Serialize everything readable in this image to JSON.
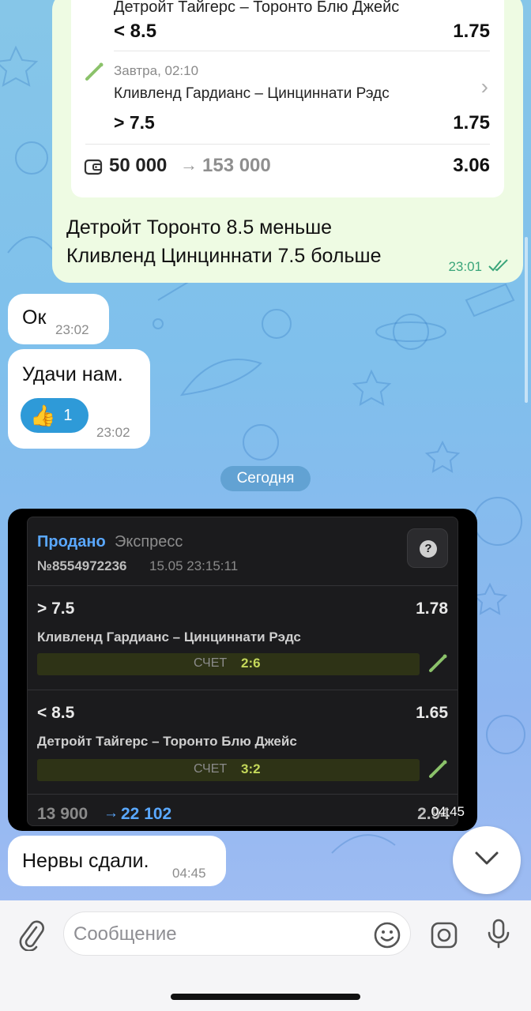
{
  "card": {
    "match1": "Детройт Тайгерс – Торонто Блю Джейс",
    "bet1": "< 8.5",
    "odd1": "1.75",
    "time2": "Завтра, 02:10",
    "match2": "Кливленд Гардианс – Цинциннати Рэдс",
    "bet2": "> 7.5",
    "odd2": "1.75",
    "stake": "50 000",
    "arrow": "→",
    "payout": "153 000",
    "total_odd": "3.06"
  },
  "outgoing_message": {
    "line1": "Детройт Торонто 8.5 меньше",
    "line2": "Кливленд Цинциннати 7.5 больше",
    "time": "23:01"
  },
  "incoming": [
    {
      "text": "Ок",
      "time": "23:02"
    },
    {
      "text": "Удачи нам.",
      "time": "23:02",
      "reaction_emoji": "👍",
      "reaction_count": "1"
    }
  ],
  "date_divider": "Сегодня",
  "screenshot": {
    "status": "Продано",
    "type": "Экспресс",
    "number": "№8554972236",
    "datetime": "15.05 23:15:11",
    "help": "?",
    "legs": [
      {
        "bet": "> 7.5",
        "odd": "1.78",
        "match": "Кливленд Гардианс – Цинциннати Рэдс",
        "score_label": "СЧЕТ",
        "score": "2:6"
      },
      {
        "bet": "< 8.5",
        "odd": "1.65",
        "match": "Детройт Тайгерс – Торонто Блю Джейс",
        "score_label": "СЧЕТ",
        "score": "3:2"
      }
    ],
    "stake": "13 900",
    "arrow": "→",
    "payout": "22 102",
    "total_odd": "2.94",
    "time": "04:45"
  },
  "last_message": {
    "text": "Нервы сдали.",
    "time": "04:45"
  },
  "composer": {
    "placeholder": "Сообщение"
  },
  "colors": {
    "outgoing_bubble": "#eefbe3",
    "accent_blue": "#2e9ad8",
    "sold_blue": "#5aa8ff",
    "score_green": "#c4d85a"
  }
}
